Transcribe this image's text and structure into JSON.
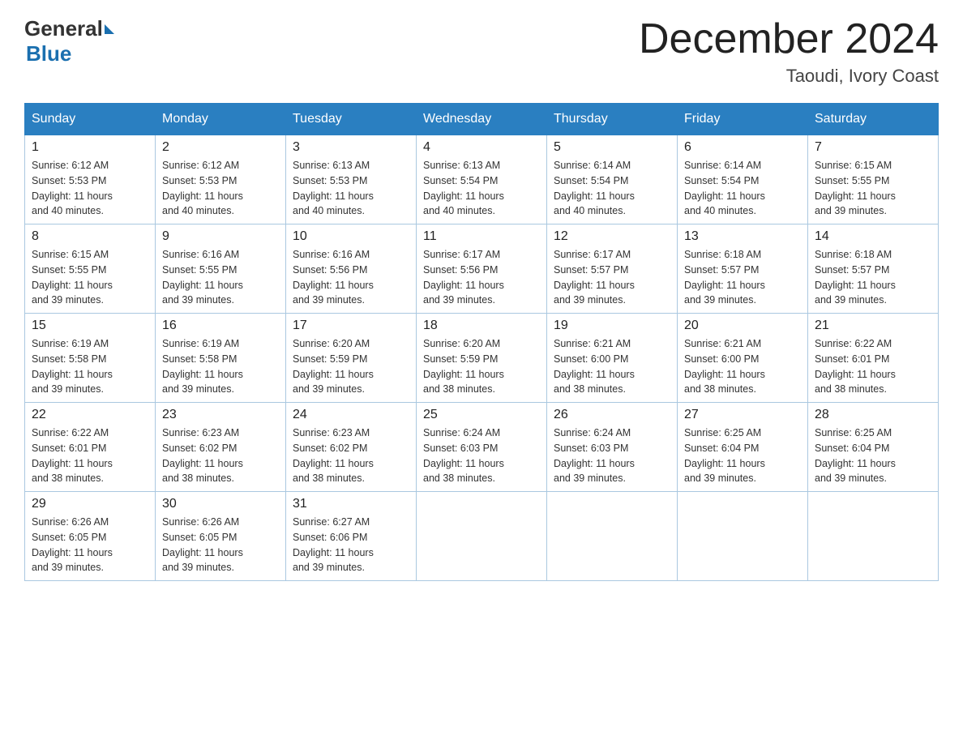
{
  "logo": {
    "general": "General",
    "blue": "Blue"
  },
  "title": {
    "month_year": "December 2024",
    "location": "Taoudi, Ivory Coast"
  },
  "weekdays": [
    "Sunday",
    "Monday",
    "Tuesday",
    "Wednesday",
    "Thursday",
    "Friday",
    "Saturday"
  ],
  "weeks": [
    [
      {
        "day": "1",
        "sunrise": "6:12 AM",
        "sunset": "5:53 PM",
        "daylight": "11 hours and 40 minutes."
      },
      {
        "day": "2",
        "sunrise": "6:12 AM",
        "sunset": "5:53 PM",
        "daylight": "11 hours and 40 minutes."
      },
      {
        "day": "3",
        "sunrise": "6:13 AM",
        "sunset": "5:53 PM",
        "daylight": "11 hours and 40 minutes."
      },
      {
        "day": "4",
        "sunrise": "6:13 AM",
        "sunset": "5:54 PM",
        "daylight": "11 hours and 40 minutes."
      },
      {
        "day": "5",
        "sunrise": "6:14 AM",
        "sunset": "5:54 PM",
        "daylight": "11 hours and 40 minutes."
      },
      {
        "day": "6",
        "sunrise": "6:14 AM",
        "sunset": "5:54 PM",
        "daylight": "11 hours and 40 minutes."
      },
      {
        "day": "7",
        "sunrise": "6:15 AM",
        "sunset": "5:55 PM",
        "daylight": "11 hours and 39 minutes."
      }
    ],
    [
      {
        "day": "8",
        "sunrise": "6:15 AM",
        "sunset": "5:55 PM",
        "daylight": "11 hours and 39 minutes."
      },
      {
        "day": "9",
        "sunrise": "6:16 AM",
        "sunset": "5:55 PM",
        "daylight": "11 hours and 39 minutes."
      },
      {
        "day": "10",
        "sunrise": "6:16 AM",
        "sunset": "5:56 PM",
        "daylight": "11 hours and 39 minutes."
      },
      {
        "day": "11",
        "sunrise": "6:17 AM",
        "sunset": "5:56 PM",
        "daylight": "11 hours and 39 minutes."
      },
      {
        "day": "12",
        "sunrise": "6:17 AM",
        "sunset": "5:57 PM",
        "daylight": "11 hours and 39 minutes."
      },
      {
        "day": "13",
        "sunrise": "6:18 AM",
        "sunset": "5:57 PM",
        "daylight": "11 hours and 39 minutes."
      },
      {
        "day": "14",
        "sunrise": "6:18 AM",
        "sunset": "5:57 PM",
        "daylight": "11 hours and 39 minutes."
      }
    ],
    [
      {
        "day": "15",
        "sunrise": "6:19 AM",
        "sunset": "5:58 PM",
        "daylight": "11 hours and 39 minutes."
      },
      {
        "day": "16",
        "sunrise": "6:19 AM",
        "sunset": "5:58 PM",
        "daylight": "11 hours and 39 minutes."
      },
      {
        "day": "17",
        "sunrise": "6:20 AM",
        "sunset": "5:59 PM",
        "daylight": "11 hours and 39 minutes."
      },
      {
        "day": "18",
        "sunrise": "6:20 AM",
        "sunset": "5:59 PM",
        "daylight": "11 hours and 38 minutes."
      },
      {
        "day": "19",
        "sunrise": "6:21 AM",
        "sunset": "6:00 PM",
        "daylight": "11 hours and 38 minutes."
      },
      {
        "day": "20",
        "sunrise": "6:21 AM",
        "sunset": "6:00 PM",
        "daylight": "11 hours and 38 minutes."
      },
      {
        "day": "21",
        "sunrise": "6:22 AM",
        "sunset": "6:01 PM",
        "daylight": "11 hours and 38 minutes."
      }
    ],
    [
      {
        "day": "22",
        "sunrise": "6:22 AM",
        "sunset": "6:01 PM",
        "daylight": "11 hours and 38 minutes."
      },
      {
        "day": "23",
        "sunrise": "6:23 AM",
        "sunset": "6:02 PM",
        "daylight": "11 hours and 38 minutes."
      },
      {
        "day": "24",
        "sunrise": "6:23 AM",
        "sunset": "6:02 PM",
        "daylight": "11 hours and 38 minutes."
      },
      {
        "day": "25",
        "sunrise": "6:24 AM",
        "sunset": "6:03 PM",
        "daylight": "11 hours and 38 minutes."
      },
      {
        "day": "26",
        "sunrise": "6:24 AM",
        "sunset": "6:03 PM",
        "daylight": "11 hours and 39 minutes."
      },
      {
        "day": "27",
        "sunrise": "6:25 AM",
        "sunset": "6:04 PM",
        "daylight": "11 hours and 39 minutes."
      },
      {
        "day": "28",
        "sunrise": "6:25 AM",
        "sunset": "6:04 PM",
        "daylight": "11 hours and 39 minutes."
      }
    ],
    [
      {
        "day": "29",
        "sunrise": "6:26 AM",
        "sunset": "6:05 PM",
        "daylight": "11 hours and 39 minutes."
      },
      {
        "day": "30",
        "sunrise": "6:26 AM",
        "sunset": "6:05 PM",
        "daylight": "11 hours and 39 minutes."
      },
      {
        "day": "31",
        "sunrise": "6:27 AM",
        "sunset": "6:06 PM",
        "daylight": "11 hours and 39 minutes."
      },
      null,
      null,
      null,
      null
    ]
  ],
  "labels": {
    "sunrise": "Sunrise:",
    "sunset": "Sunset:",
    "daylight": "Daylight:"
  }
}
